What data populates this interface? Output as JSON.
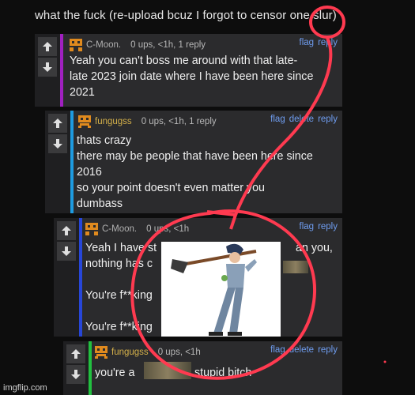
{
  "title": "what the fuck (re-upload bcuz I forgot to censor one slur)",
  "actions": {
    "flag": "flag",
    "delete": "delete",
    "reply": "reply"
  },
  "comments": [
    {
      "user": "C-Moon.",
      "meta": "0 ups, <1h, 1 reply",
      "bar_color": "#a020c0",
      "user_color": "#b0b0b0",
      "lines": [
        "Yeah you can't boss me around with that late-",
        "late 2023 join date where I have been here since",
        "2021"
      ]
    },
    {
      "user": "fungugss",
      "meta": "0 ups, <1h, 1 reply",
      "bar_color": "#1e9be0",
      "user_color": "#d4b04a",
      "lines": [
        "thats crazy",
        "there may be people that have been here since",
        "2016",
        "so your point doesn't even matter you",
        "dumbass"
      ]
    },
    {
      "user": "C-Moon.",
      "meta": "0 ups, <1h",
      "bar_color": "#2746d8",
      "user_color": "#b0b0b0",
      "lines": [
        "Yeah I have st",
        "nothing has c",
        "",
        "You're f**king",
        "",
        "You're f**king"
      ],
      "line_tail": "an you,"
    },
    {
      "user": "fungugss",
      "meta": "0 ups, <1h",
      "bar_color": "#22c040",
      "user_color": "#d4b04a",
      "lines": [
        "you're a"
      ],
      "line_tail": "stupid bitch"
    }
  ],
  "watermark": "imgflip.com",
  "colors": {
    "annotation": "#ff3a50",
    "link": "#6f9df0",
    "panel": "#2b2b2d"
  },
  "icons": [
    "upvote-arrow-icon",
    "downvote-arrow-icon",
    "user-avatar-icon"
  ]
}
